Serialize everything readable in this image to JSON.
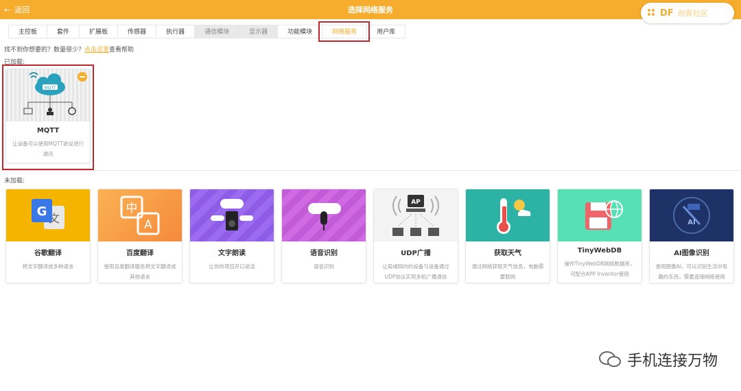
{
  "topbar": {
    "back_label": "返回",
    "title": "选择网络服务"
  },
  "badge": {
    "brand": "DF",
    "sub": "创客社区"
  },
  "tabs": [
    {
      "label": "主控板",
      "state": "normal"
    },
    {
      "label": "套件",
      "state": "normal"
    },
    {
      "label": "扩展板",
      "state": "normal"
    },
    {
      "label": "传感器",
      "state": "normal"
    },
    {
      "label": "执行器",
      "state": "normal"
    },
    {
      "label": "通信模块",
      "state": "gray"
    },
    {
      "label": "显示器",
      "state": "gray"
    },
    {
      "label": "功能模块",
      "state": "normal"
    },
    {
      "label": "网络服务",
      "state": "active"
    },
    {
      "label": "用户库",
      "state": "normal"
    }
  ],
  "hint": {
    "prefix": "找不到你想要的？数量很少？",
    "link": "点击这里",
    "suffix": "查看帮助"
  },
  "loaded_label": "已加载:",
  "unloaded_label": "未加载:",
  "loaded": [
    {
      "name": "MQTT",
      "desc": "让设备可以使用MQTT协议进行通讯",
      "icon": "mqtt-cloud-icon"
    }
  ],
  "unloaded": [
    {
      "name": "谷歌翻译",
      "desc": "将文字翻译成多种语言",
      "icon": "google-translate-icon",
      "color": "#f4b400"
    },
    {
      "name": "百度翻译",
      "desc": "使用百度翻译服务将文字翻译成其他语言",
      "icon": "baidu-translate-icon",
      "color": "#f7a048"
    },
    {
      "name": "文字朗读",
      "desc": "让你的项目开口说话",
      "icon": "speaker-icon",
      "color": "#8e5ce6"
    },
    {
      "name": "语音识别",
      "desc": "语音识别",
      "icon": "microphone-icon",
      "color": "#c35ad8"
    },
    {
      "name": "UDP广播",
      "desc": "让局域网内的设备与设备通过UDP协议实现多机广播通信",
      "icon": "udp-broadcast-icon",
      "color": "#f2f2f2"
    },
    {
      "name": "获取天气",
      "desc": "通过网络获取天气信息，电脑需要联网",
      "icon": "thermometer-icon",
      "color": "#2db3a5"
    },
    {
      "name": "TinyWebDB",
      "desc": "操作TinyWebDB网络数据库，可配合APP Inventor使用",
      "icon": "database-icon",
      "color": "#58e0b5"
    },
    {
      "name": "AI图像识别",
      "desc": "使用图像AI，可以识别生活中有趣的东西，需要连接网络使用",
      "icon": "ai-image-icon",
      "color": "#1f3268"
    }
  ],
  "watermark": "手机连接万物"
}
